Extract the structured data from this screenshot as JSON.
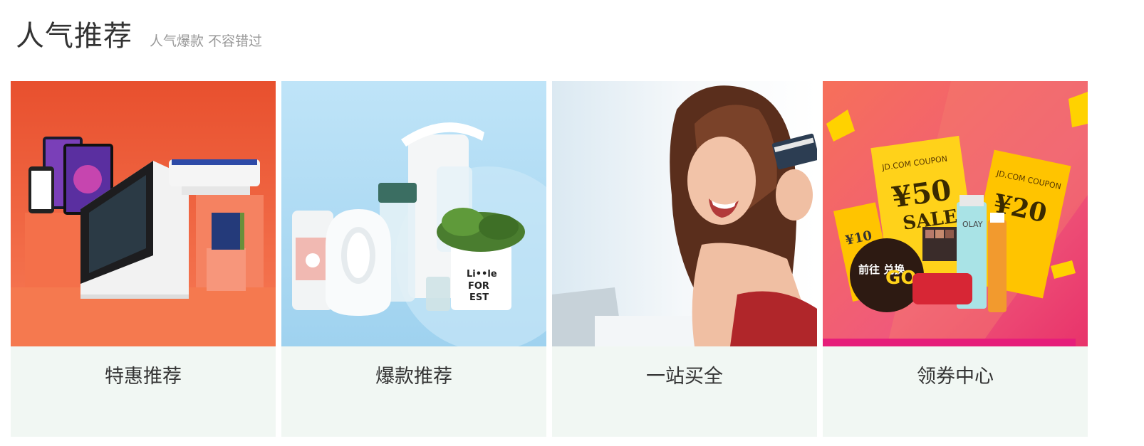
{
  "section": {
    "title": "人气推荐",
    "subtitle": "人气爆款 不容错过"
  },
  "cards": [
    {
      "label": "特惠推荐",
      "icon": "electronics-image",
      "bg": "#f05a36"
    },
    {
      "label": "爆款推荐",
      "icon": "home-appliances-image",
      "bg": "#b9e1f6"
    },
    {
      "label": "一站买全",
      "icon": "shopping-woman-image",
      "bg": "#eef3f7"
    },
    {
      "label": "领券中心",
      "icon": "coupon-center-image",
      "bg": "#f2586a",
      "image_text": {
        "coupon_brand": "JD.COM COUPON",
        "coupon_1": "¥50",
        "coupon_2": "¥20",
        "coupon_3": "¥10",
        "sale": "SALE",
        "go_button": "前往 兑换",
        "go": "GO",
        "brand": "OLAY"
      }
    }
  ]
}
